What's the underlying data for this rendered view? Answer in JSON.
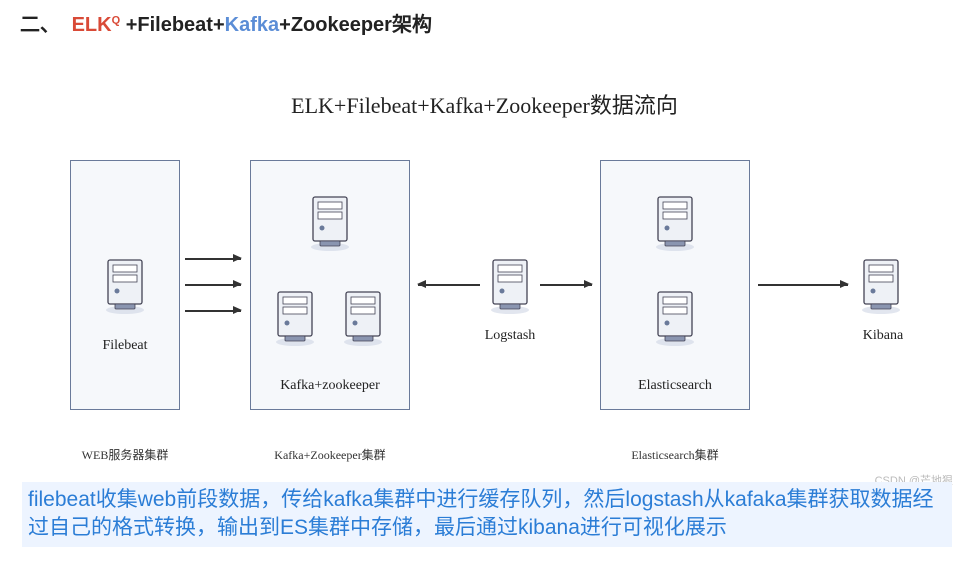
{
  "heading": {
    "section_num": "二、",
    "elk": "ELK",
    "sup": "Q",
    "plus1": "+",
    "filebeat": "Filebeat",
    "plus2": "+",
    "kafka": "Kafka",
    "plus3": "+",
    "rest": "Zookeeper架构"
  },
  "diagram_title": "ELK+Filebeat+Kafka+Zookeeper数据流向",
  "nodes": {
    "filebeat_label": "Filebeat",
    "kafka_label": "Kafka+zookeeper",
    "logstash_label": "Logstash",
    "es_label": "Elasticsearch",
    "kibana_label": "Kibana"
  },
  "clusters": {
    "web": "WEB服务器集群",
    "kafka": "Kafka+Zookeeper集群",
    "es": "Elasticsearch集群"
  },
  "description": "filebeat收集web前段数据，传给kafka集群中进行缓存队列，然后logstash从kafaka集群获取数据经过自己的格式转换，输出到ES集群中存储，最后通过kibana进行可视化展示",
  "watermark": "CSDN @芒地狠"
}
